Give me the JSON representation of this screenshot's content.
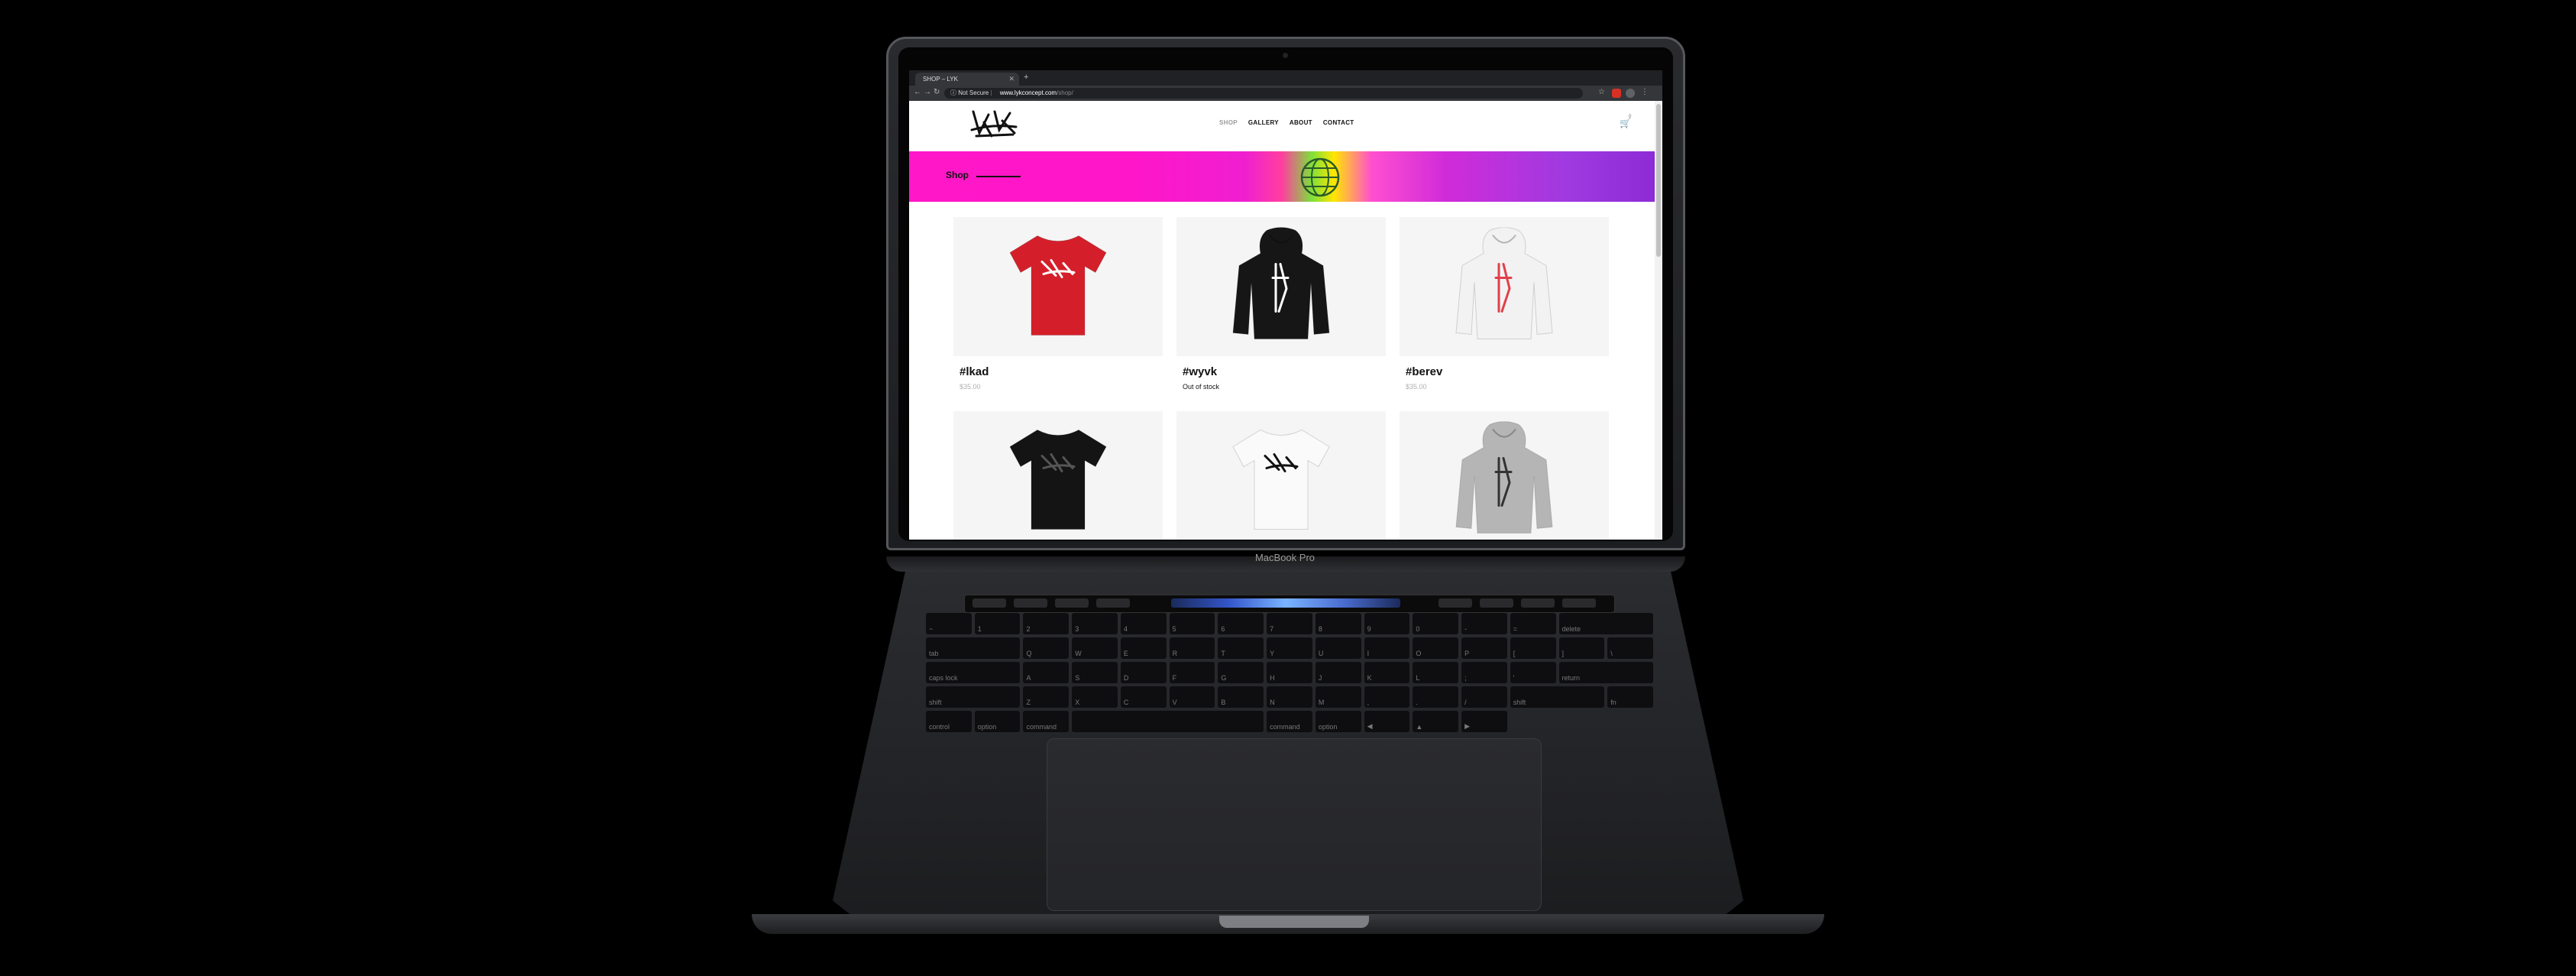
{
  "device": {
    "model_label": "MacBook Pro"
  },
  "browser": {
    "tab_title": "SHOP – LYK",
    "new_tab_symbol": "+",
    "security_label": "Not Secure",
    "url_host": "www.lykconcept.com",
    "url_path": "/shop/"
  },
  "site": {
    "nav": [
      {
        "label": "SHOP",
        "active": true
      },
      {
        "label": "GALLERY",
        "active": false
      },
      {
        "label": "ABOUT",
        "active": false
      },
      {
        "label": "CONTACT",
        "active": false
      }
    ],
    "cart_count": "0",
    "banner_title": "Shop",
    "products": [
      {
        "name": "#lkad",
        "sub": "$35.00",
        "sub_type": "price",
        "garment": "tshirt",
        "color": "#d41f2a",
        "print": "#ffffff"
      },
      {
        "name": "#wyvk",
        "sub": "Out of stock",
        "sub_type": "oos",
        "garment": "hoodie",
        "color": "#161616",
        "print": "#ffffff"
      },
      {
        "name": "#berev",
        "sub": "$35.00",
        "sub_type": "price",
        "garment": "hoodie",
        "color": "#f2f2f2",
        "print": "#e0404a"
      },
      {
        "name": "",
        "sub": "",
        "sub_type": "price",
        "garment": "tshirt",
        "color": "#141414",
        "print": "#555555"
      },
      {
        "name": "",
        "sub": "",
        "sub_type": "price",
        "garment": "tshirt",
        "color": "#fafafa",
        "print": "#111111"
      },
      {
        "name": "",
        "sub": "",
        "sub_type": "price",
        "garment": "hoodie",
        "color": "#b5b5b5",
        "print": "#333333"
      }
    ]
  },
  "keyboard": {
    "rows": [
      [
        "~",
        "1",
        "2",
        "3",
        "4",
        "5",
        "6",
        "7",
        "8",
        "9",
        "0",
        "-",
        "=",
        "delete"
      ],
      [
        "tab",
        "Q",
        "W",
        "E",
        "R",
        "T",
        "Y",
        "U",
        "I",
        "O",
        "P",
        "[",
        "]",
        "\\"
      ],
      [
        "caps lock",
        "A",
        "S",
        "D",
        "F",
        "G",
        "H",
        "J",
        "K",
        "L",
        ";",
        "'",
        "return"
      ],
      [
        "shift",
        "Z",
        "X",
        "C",
        "V",
        "B",
        "N",
        "M",
        ",",
        ".",
        "/",
        "shift"
      ],
      [
        "fn",
        "control",
        "option",
        "command",
        "",
        "command",
        "option",
        "◀",
        "▲",
        "▶"
      ]
    ]
  }
}
